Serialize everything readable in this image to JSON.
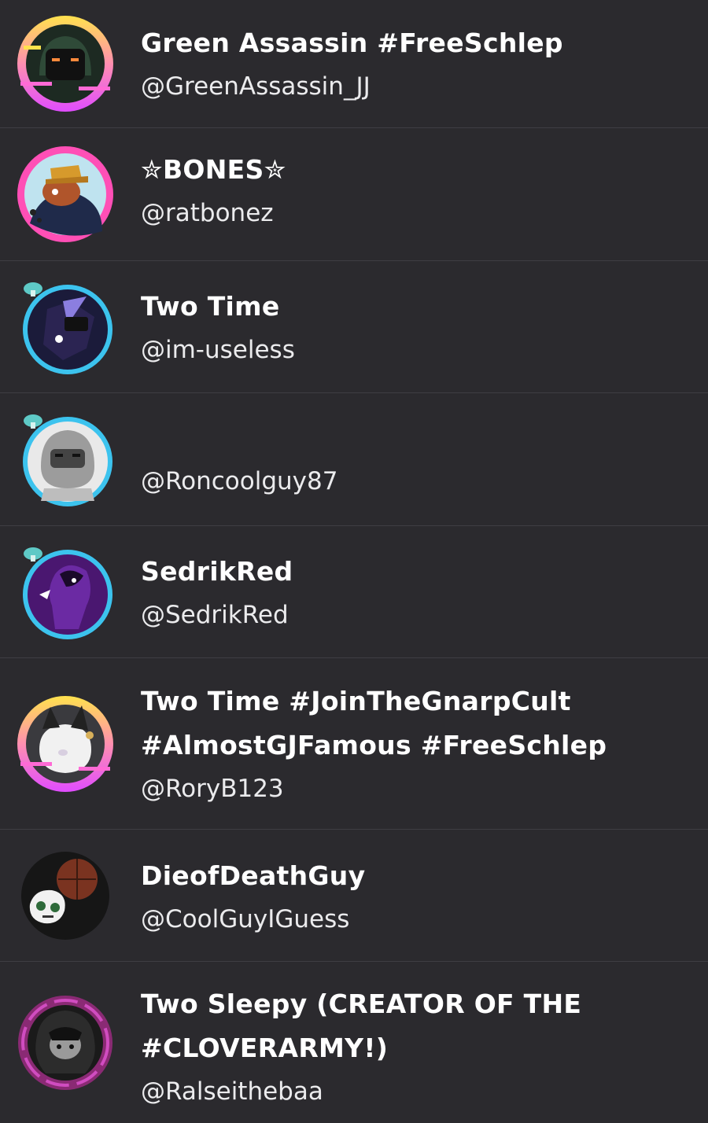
{
  "users": [
    {
      "display_name": "Green Assassin #FreeSchlep",
      "handle": "@GreenAssassin_JJ",
      "frame": "rainbow",
      "avatar_icon": "hooded-figure-icon"
    },
    {
      "display_name": "✮BONES✮",
      "handle": "@ratbonez",
      "frame": "pink",
      "avatar_icon": "rat-character-icon"
    },
    {
      "display_name": "Two Time",
      "handle": "@im-useless",
      "frame": "mushroom-cyan",
      "avatar_icon": "dark-character-icon"
    },
    {
      "display_name": "",
      "handle": "@Roncoolguy87",
      "frame": "mushroom-cyan",
      "avatar_icon": "grey-hood-character-icon"
    },
    {
      "display_name": "SedrikRed",
      "handle": "@SedrikRed",
      "frame": "mushroom-cyan",
      "avatar_icon": "purple-character-icon"
    },
    {
      "display_name": "Two Time #JoinTheGnarpCult\n#AlmostGJFamous #FreeSchlep",
      "handle": "@RoryB123",
      "frame": "rainbow",
      "avatar_icon": "white-creature-icon"
    },
    {
      "display_name": "DieofDeathGuy",
      "handle": "@CoolGuyIGuess",
      "frame": "none",
      "avatar_icon": "skull-basketball-icon"
    },
    {
      "display_name": "Two Sleepy (CREATOR OF THE\n#CLOVERARMY!)",
      "handle": "@Ralseithebaa",
      "frame": "purple-swirl",
      "avatar_icon": "dark-hair-character-icon"
    }
  ],
  "colors": {
    "background": "#2b2a2e",
    "divider": "#3f3e43",
    "text": "#ffffff",
    "frame_cyan": "#3cc3ee",
    "frame_pink": "#ff4fb6",
    "frame_yellow": "#ffe14d"
  }
}
